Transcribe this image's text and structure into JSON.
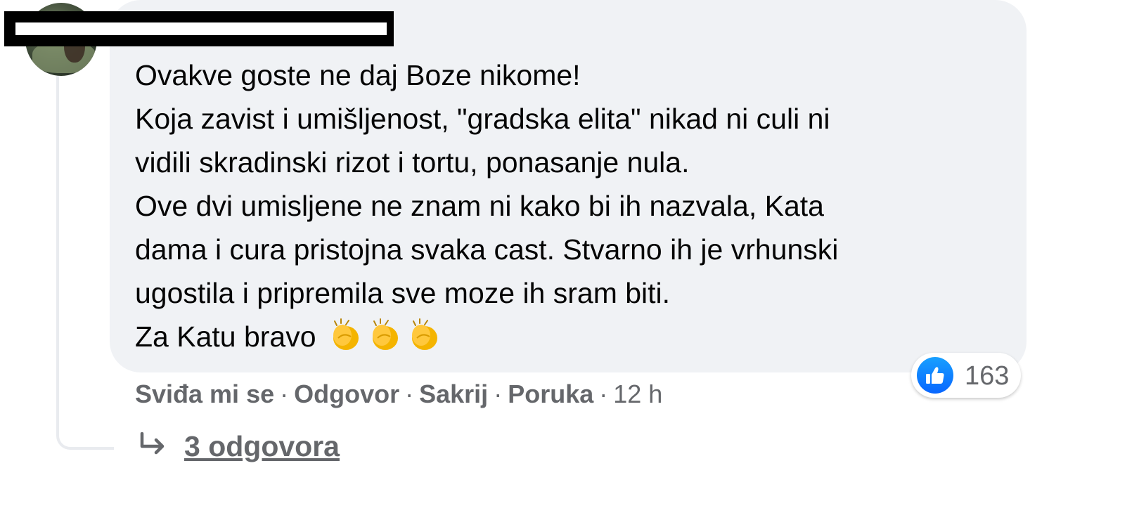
{
  "comment": {
    "lines": [
      "Ovakve goste ne daj Boze nikome!",
      "Koja zavist i umišljenost, \"gradska elita\" nikad ni culi ni",
      "vidili skradinski rizot i tortu, ponasanje nula.",
      "Ove dvi umisljene ne znam ni kako bi ih nazvala, Kata",
      "dama i cura pristojna svaka cast. Stvarno ih je vrhunski",
      "ugostila i pripremila sve moze ih sram biti.",
      "Za Katu bravo"
    ],
    "emoji_icon": "clapping-hands-icon",
    "emoji_count": 3
  },
  "reactions": {
    "icon": "thumbs-up-icon",
    "count": "163",
    "color": "#0866ff"
  },
  "actions": {
    "like": "Sviđa mi se",
    "reply": "Odgovor",
    "hide": "Sakrij",
    "message": "Poruka",
    "separator": "·",
    "time": "12 h"
  },
  "replies": {
    "icon": "reply-arrow-icon",
    "label": "3 odgovora"
  },
  "colors": {
    "bubble": "#f0f2f5",
    "secondary_text": "#65676b"
  }
}
